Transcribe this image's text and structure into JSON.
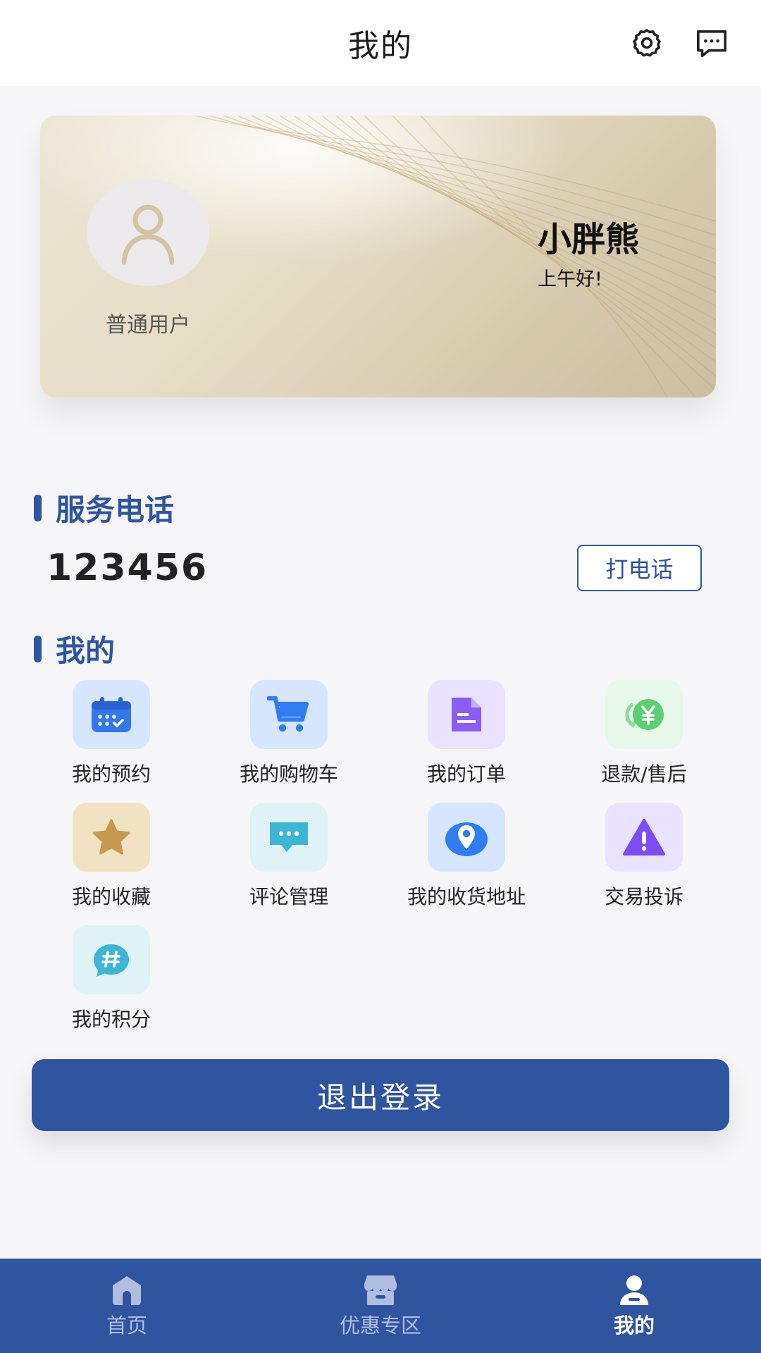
{
  "header": {
    "title": "我的",
    "settings_icon": "gear-icon",
    "message_icon": "chat-bubble-icon"
  },
  "profile": {
    "level": "普通用户",
    "name": "小胖熊",
    "greeting": "上午好!",
    "avatar_icon": "user-silhouette-icon"
  },
  "service": {
    "title": "服务电话",
    "phone": "123456",
    "call_label": "打电话"
  },
  "mine": {
    "title": "我的",
    "items": [
      {
        "label": "我的预约",
        "icon": "calendar-icon",
        "bg": "#d6e6ff",
        "color": "#3478f0"
      },
      {
        "label": "我的购物车",
        "icon": "shopping-cart-icon",
        "bg": "#d6e6ff",
        "color": "#2f7df0"
      },
      {
        "label": "我的订单",
        "icon": "document-icon",
        "bg": "#e9e3ff",
        "color": "#8b5cf6"
      },
      {
        "label": "退款/售后",
        "icon": "refund-yen-icon",
        "bg": "#e6f8ea",
        "color": "#5ccf73"
      },
      {
        "label": "我的收藏",
        "icon": "star-icon",
        "bg": "#f2e2c4",
        "color": "#c59a4f"
      },
      {
        "label": "评论管理",
        "icon": "comment-icon",
        "bg": "#dff3f7",
        "color": "#3cb6d2"
      },
      {
        "label": "我的收货地址",
        "icon": "location-pin-icon",
        "bg": "#d6e6ff",
        "color": "#2f7df0"
      },
      {
        "label": "交易投诉",
        "icon": "warning-icon",
        "bg": "#e9e3ff",
        "color": "#7c4df2"
      },
      {
        "label": "我的积分",
        "icon": "hashtag-bubble-icon",
        "bg": "#dff3f7",
        "color": "#3cb6d2"
      }
    ]
  },
  "logout_label": "退出登录",
  "nav": {
    "items": [
      {
        "label": "首页",
        "icon": "home-icon",
        "active": false
      },
      {
        "label": "优惠专区",
        "icon": "store-icon",
        "active": false
      },
      {
        "label": "我的",
        "icon": "person-icon",
        "active": true
      }
    ]
  },
  "colors": {
    "primary": "#2f54a0",
    "nav_inactive": "#aebde0"
  }
}
